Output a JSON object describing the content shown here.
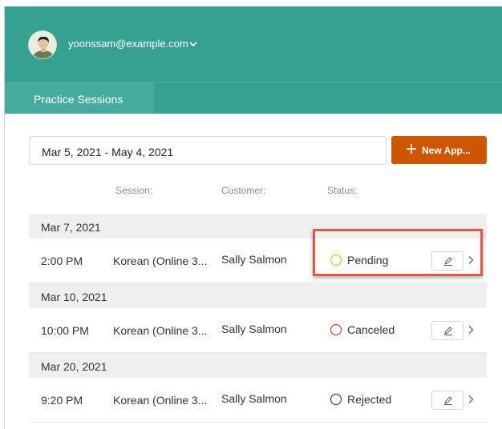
{
  "header": {
    "user_email": "yoonssam@example.com",
    "background_color": "#36a191",
    "tabs": [
      {
        "label": "Practice Sessions",
        "active": true
      }
    ]
  },
  "filters": {
    "date_range": "Mar 5, 2021 - May 4, 2021",
    "new_button_label": "New App...",
    "new_button_color": "#cd5600"
  },
  "columns": {
    "session": "Session:",
    "customer": "Customer:",
    "status": "Status:"
  },
  "groups": [
    {
      "date": "Mar 7, 2021",
      "rows": [
        {
          "time": "2:00 PM",
          "session": "Korean (Online 3...",
          "customer": "Sally Salmon",
          "status": "Pending",
          "status_color": "#e6b800"
        }
      ]
    },
    {
      "date": "Mar 10, 2021",
      "rows": [
        {
          "time": "10:00 PM",
          "session": "Korean (Online 3...",
          "customer": "Sally Salmon",
          "status": "Canceled",
          "status_color": "#cc2222"
        }
      ]
    },
    {
      "date": "Mar 20, 2021",
      "rows": [
        {
          "time": "9:20 PM",
          "session": "Korean (Online 3...",
          "customer": "Sally Salmon",
          "status": "Rejected",
          "status_color": "#222222"
        }
      ]
    }
  ],
  "icons": {
    "avatar": "user-avatar",
    "dropdown": "chevron-down-icon",
    "new": "plus-icon",
    "edit": "pen-icon",
    "row_nav": "chevron-right-icon"
  },
  "highlight_color": "#e05a47"
}
